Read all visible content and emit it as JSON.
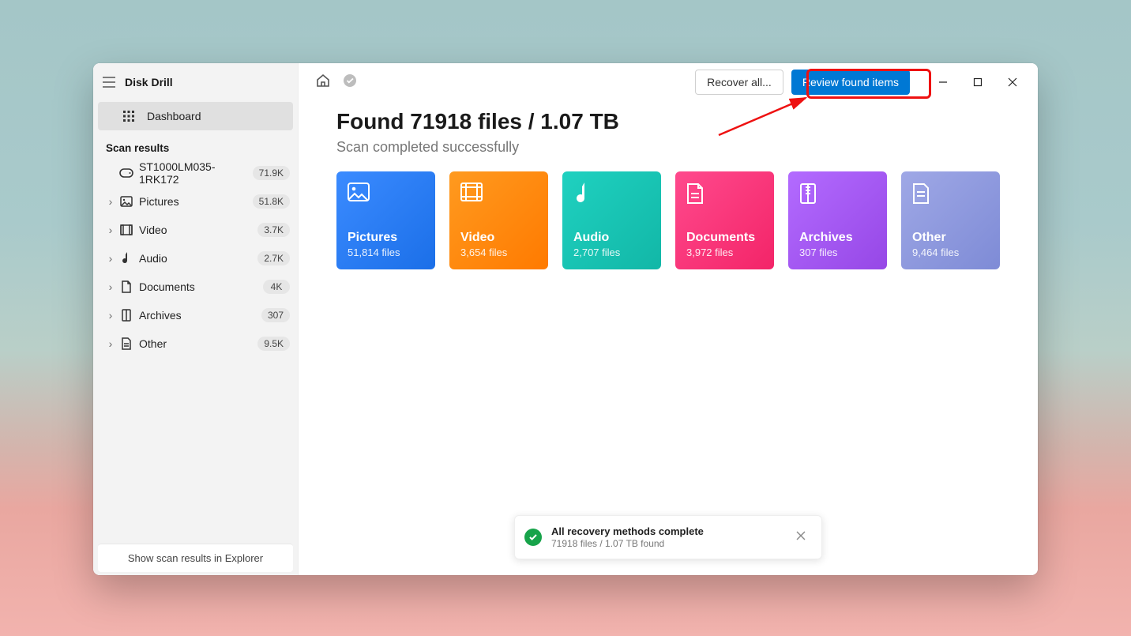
{
  "app": {
    "title": "Disk Drill"
  },
  "sidebar": {
    "dashboard_label": "Dashboard",
    "section_label": "Scan results",
    "footer_label": "Show scan results in Explorer",
    "items": [
      {
        "label": "ST1000LM035-1RK172",
        "badge": "71.9K"
      },
      {
        "label": "Pictures",
        "badge": "51.8K"
      },
      {
        "label": "Video",
        "badge": "3.7K"
      },
      {
        "label": "Audio",
        "badge": "2.7K"
      },
      {
        "label": "Documents",
        "badge": "4K"
      },
      {
        "label": "Archives",
        "badge": "307"
      },
      {
        "label": "Other",
        "badge": "9.5K"
      }
    ]
  },
  "topbar": {
    "recover_label": "Recover all...",
    "review_label": "Review found items"
  },
  "main": {
    "heading": "Found 71918 files / 1.07 TB",
    "subtitle": "Scan completed successfully"
  },
  "cards": {
    "pictures": {
      "title": "Pictures",
      "count": "51,814 files"
    },
    "video": {
      "title": "Video",
      "count": "3,654 files"
    },
    "audio": {
      "title": "Audio",
      "count": "2,707 files"
    },
    "documents": {
      "title": "Documents",
      "count": "3,972 files"
    },
    "archives": {
      "title": "Archives",
      "count": "307 files"
    },
    "other": {
      "title": "Other",
      "count": "9,464 files"
    }
  },
  "toast": {
    "title": "All recovery methods complete",
    "subtitle": "71918 files / 1.07 TB found"
  }
}
